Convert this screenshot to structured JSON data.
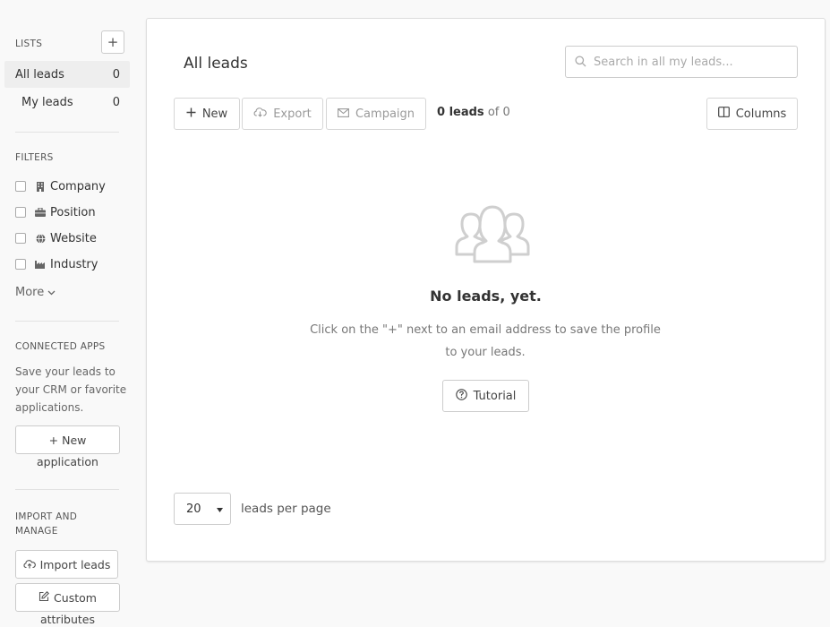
{
  "sidebar": {
    "lists_title": "LISTS",
    "add_list": "+",
    "lists": [
      {
        "label": "All leads",
        "count": "0"
      },
      {
        "label": "My leads",
        "count": "0"
      }
    ],
    "filters_title": "FILTERS",
    "filters": [
      {
        "label": "Company",
        "icon": "building-icon"
      },
      {
        "label": "Position",
        "icon": "briefcase-icon"
      },
      {
        "label": "Website",
        "icon": "globe-icon"
      },
      {
        "label": "Industry",
        "icon": "industry-icon"
      }
    ],
    "more_label": "More",
    "connected_title": "CONNECTED APPS",
    "connected_text": "Save your leads to your CRM or favorite applications.",
    "new_app_line1": "+ New",
    "new_app_line2": "application",
    "import_title": "IMPORT AND MANAGE",
    "import_label": "Import leads",
    "custom_line1": "Custom",
    "custom_line2": "attributes"
  },
  "main": {
    "title": "All leads",
    "search_placeholder": "Search in all my leads...",
    "toolbar": {
      "new_label": "New",
      "export_label": "Export",
      "campaign_label": "Campaign",
      "columns_label": "Columns"
    },
    "count": {
      "value": "0 leads",
      "of": "of 0"
    },
    "empty": {
      "title": "No leads, yet.",
      "text": "Click on the \"+\" next to an email address to save the profile to your leads.",
      "tutorial_label": "Tutorial"
    },
    "pagination": {
      "per_page_value": "20",
      "per_page_label": "leads per page"
    }
  },
  "colors": {
    "background": "#f9f9f9",
    "card": "#ffffff",
    "border": "#cccccc",
    "muted": "#9a9a9a"
  }
}
